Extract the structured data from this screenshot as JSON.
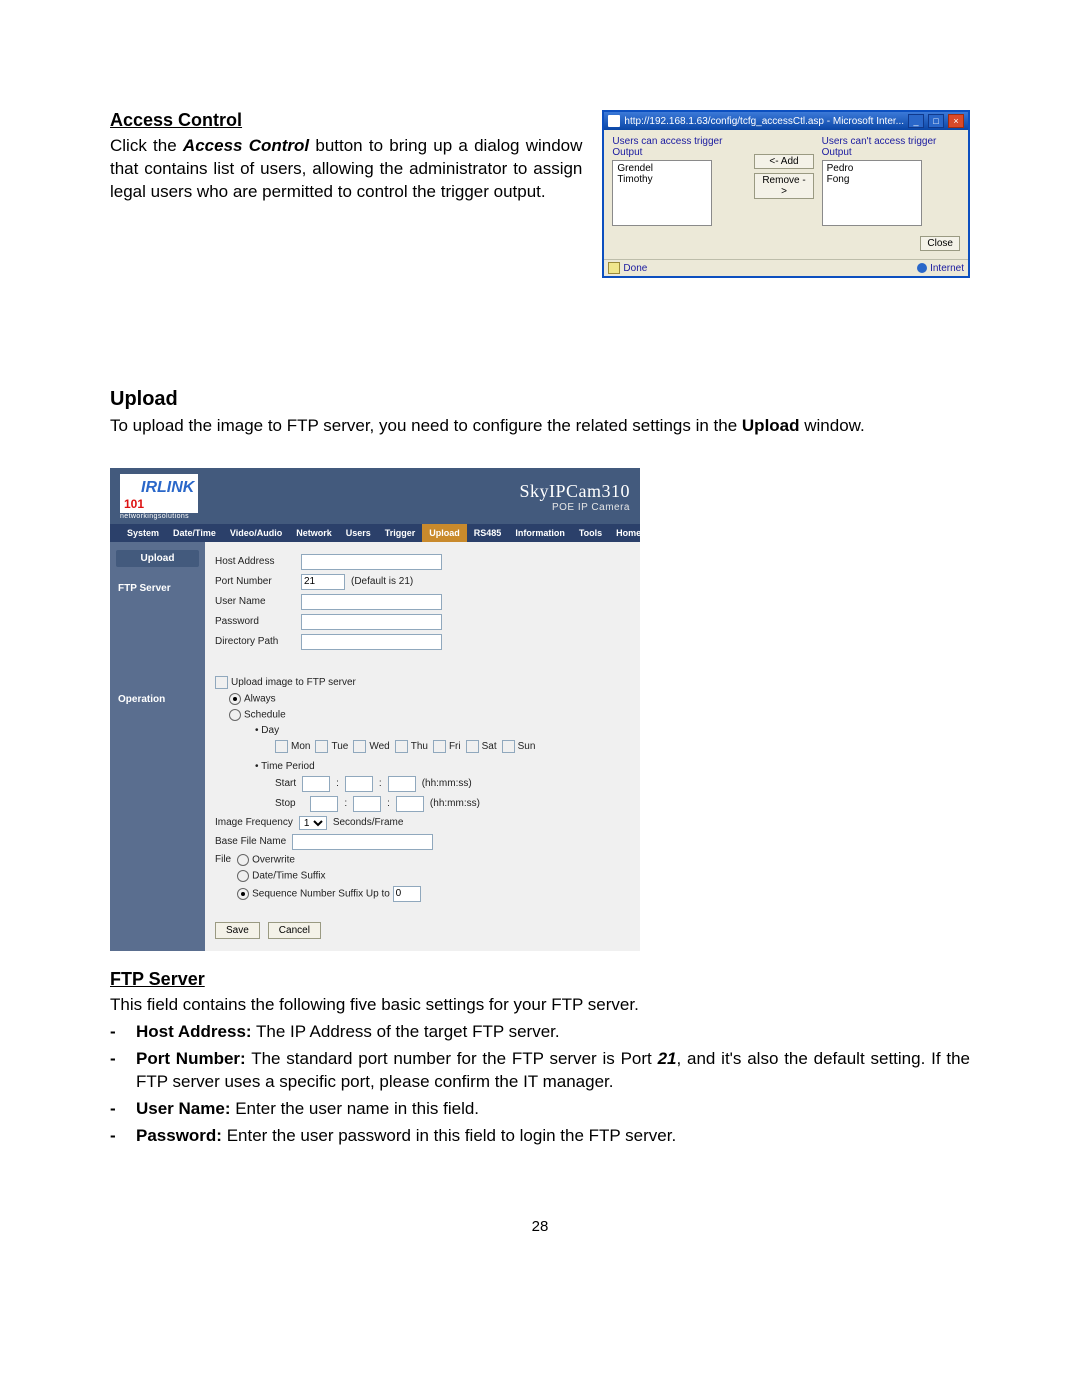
{
  "page_number": "28",
  "access_control": {
    "heading": "Access Control",
    "text_prefix": "Click the ",
    "text_bold": "Access Control",
    "text_suffix": " button to bring up a dialog window that contains list of users, allowing the administrator to assign legal users who are permitted to control the trigger output.",
    "dialog": {
      "title": "http://192.168.1.63/config/tcfg_accessCtl.asp - Microsoft Inter...",
      "left_label": "Users can access trigger Output",
      "right_label": "Users can't access trigger Output",
      "left_users": [
        "Grendel",
        "Timothy"
      ],
      "right_users": [
        "Pedro",
        "Fong"
      ],
      "add_btn": "<- Add",
      "remove_btn": "Remove ->",
      "close_btn": "Close",
      "status_done": "Done",
      "status_internet": "Internet"
    }
  },
  "upload": {
    "heading": "Upload",
    "text_prefix": "To upload the image to FTP server, you need to configure the related settings in the ",
    "text_bold": "Upload",
    "text_suffix": " window.",
    "app": {
      "logo_text": "IRLINK",
      "logo_101": "101",
      "logo_tag": "networkingsolutions",
      "brand_top": "SkyIPCam310",
      "brand_sub": "POE IP Camera",
      "nav": [
        "System",
        "Date/Time",
        "Video/Audio",
        "Network",
        "Users",
        "Trigger",
        "Upload",
        "RS485",
        "Information",
        "Tools",
        "Home"
      ],
      "nav_active_index": 6,
      "side_tab": "Upload",
      "side_ftp": "FTP Server",
      "side_op": "Operation",
      "ftp": {
        "host_label": "Host Address",
        "port_label": "Port Number",
        "port_value": "21",
        "port_hint": "(Default is 21)",
        "user_label": "User Name",
        "pass_label": "Password",
        "dir_label": "Directory Path"
      },
      "op": {
        "chk_upload": "Upload image to FTP server",
        "opt_always": "Always",
        "opt_schedule": "Schedule",
        "day_label": "Day",
        "days": [
          "Mon",
          "Tue",
          "Wed",
          "Thu",
          "Fri",
          "Sat",
          "Sun"
        ],
        "time_label": "Time Period",
        "start_label": "Start",
        "stop_label": "Stop",
        "hhmmss": "(hh:mm:ss)",
        "freq_label": "Image Frequency",
        "freq_val": "1",
        "freq_unit": "Seconds/Frame",
        "basefile_label": "Base File Name",
        "file_label": "File",
        "overwrite": "Overwrite",
        "datetime": "Date/Time Suffix",
        "seq_label": "Sequence Number Suffix Up to",
        "seq_val": "0",
        "save": "Save",
        "cancel": "Cancel"
      }
    }
  },
  "ftp_section": {
    "heading": "FTP Server",
    "intro": "This field contains the following five basic settings for your FTP server.",
    "items": {
      "host_b": "Host Address:",
      "host_t": " The IP Address of the target FTP server.",
      "port_b": "Port Number:",
      "port_t1": " The standard port number for the FTP server is Port ",
      "port_21": "21",
      "port_t2": ", and it's also the default setting. If the FTP server uses a specific port, please confirm the IT manager.",
      "user_b": "User Name:",
      "user_t": " Enter the user name in this field.",
      "pass_b": "Password:",
      "pass_t": " Enter the user password in this field to login the FTP server."
    }
  }
}
